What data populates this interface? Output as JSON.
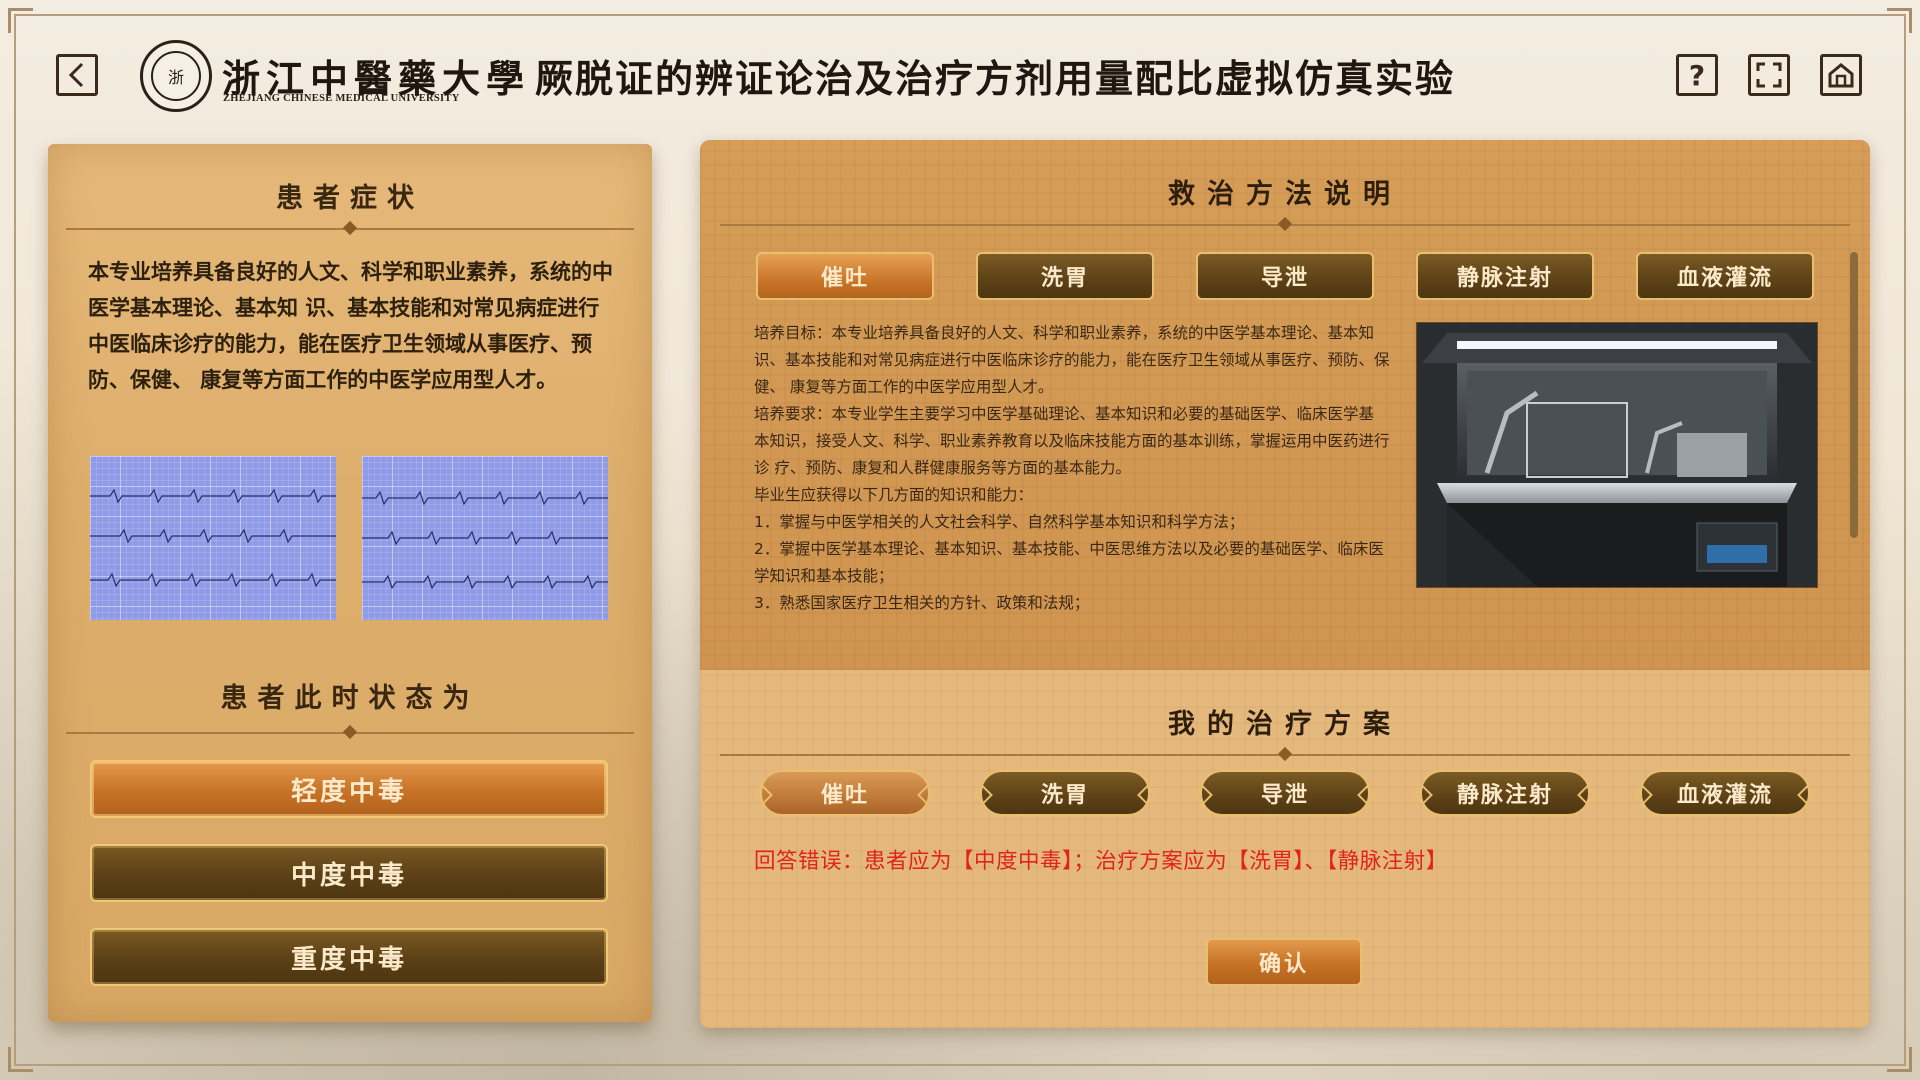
{
  "header": {
    "back_icon": "chevron-left-icon",
    "university_cn": "浙江中醫藥大學",
    "university_en": "ZHEJIANG CHINESE MEDICAL UNIVERSITY",
    "title_separator": "·",
    "title": "厥脱证的辨证论治及治疗方剂用量配比虚拟仿真实验",
    "help_label": "?",
    "fullscreen_icon": "fullscreen-icon",
    "home_icon": "home-icon"
  },
  "symptoms": {
    "heading": "患者症状",
    "text": "本专业培养具备良好的人文、科学和职业素养，系统的中医学基本理论、基本知 识、基本技能和对常见病症进行中医临床诊疗的能力，能在医疗卫生领域从事医疗、预防、保健、 康复等方面工作的中医学应用型人才。"
  },
  "status": {
    "heading": "患者此时状态为",
    "options": [
      "轻度中毒",
      "中度中毒",
      "重度中毒"
    ],
    "selected": "轻度中毒"
  },
  "methods": {
    "heading": "救治方法说明",
    "tabs": [
      "催吐",
      "洗胃",
      "导泄",
      "静脉注射",
      "血液灌流"
    ],
    "active_tab": "催吐",
    "description": [
      "培养目标：本专业培养具备良好的人文、科学和职业素养，系统的中医学基本理论、基本知 识、基本技能和对常见病症进行中医临床诊疗的能力，能在医疗卫生领域从事医疗、预防、保健、 康复等方面工作的中医学应用型人才。",
      "培养要求：本专业学生主要学习中医学基础理论、基本知识和必要的基础医学、临床医学基 本知识，接受人文、科学、职业素养教育以及临床技能方面的基本训练，掌握运用中医药进行诊 疗、预防、康复和人群健康服务等方面的基本能力。",
      "毕业生应获得以下几方面的知识和能力：",
      "1．掌握与中医学相关的人文社会科学、自然科学基本知识和科学方法；",
      "2．掌握中医学基本理论、基本知识、基本技能、中医思维方法以及必要的基础医学、临床医 学知识和基本技能；",
      "3．熟悉国家医疗卫生相关的方针、政策和法规；"
    ]
  },
  "plan": {
    "heading": "我的治疗方案",
    "options": [
      "催吐",
      "洗胃",
      "导泄",
      "静脉注射",
      "血液灌流"
    ],
    "selected": [
      "催吐"
    ],
    "error": "回答错误：患者应为【中度中毒】；治疗方案应为【洗胃】、【静脉注射】",
    "confirm_label": "确认"
  },
  "colors": {
    "error": "#e0231d",
    "active_button": "#c67226",
    "normal_button": "#5c4016"
  }
}
